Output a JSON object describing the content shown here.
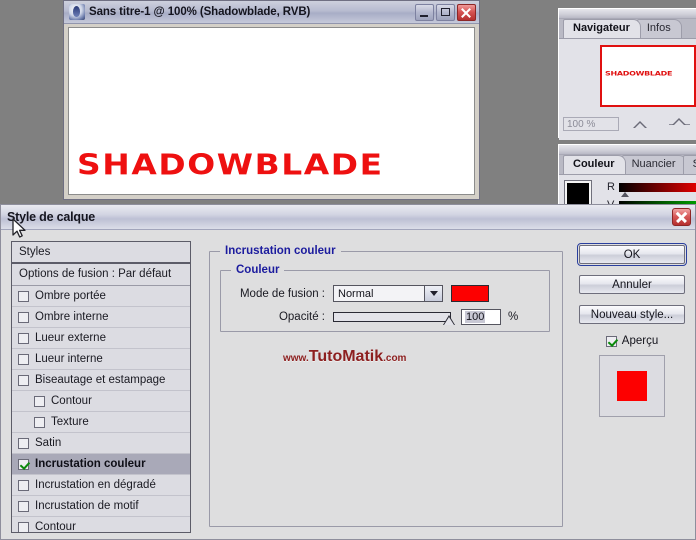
{
  "image_window": {
    "title": "Sans titre-1 @ 100% (Shadowblade, RVB)",
    "icon": "photoshop-icon",
    "minimize_label": "",
    "maximize_label": "",
    "close_label": "",
    "canvas_text": "SHADOWBLADE",
    "canvas_text_color": "#ee1010"
  },
  "navigator_palette": {
    "tabs": [
      {
        "label": "Navigateur",
        "active": true
      },
      {
        "label": "Infos",
        "active": false
      }
    ],
    "thumbnail_text": "SHADOWBLADE",
    "zoom_value": "100 %"
  },
  "color_palette": {
    "tabs": [
      {
        "label": "Couleur",
        "active": true
      },
      {
        "label": "Nuancier",
        "active": false
      },
      {
        "label": "S",
        "active": false
      }
    ],
    "channels": [
      {
        "label": "R"
      },
      {
        "label": "V"
      }
    ],
    "foreground_color": "#000000",
    "background_color": "#ffffff"
  },
  "dialog": {
    "title": "Style de calque",
    "close_label": "",
    "styles_panel": {
      "header": "Styles",
      "blending_row": "Options de fusion : Par défaut",
      "items": [
        {
          "label": "Ombre portée",
          "checked": false,
          "indent": false,
          "selected": false
        },
        {
          "label": "Ombre interne",
          "checked": false,
          "indent": false,
          "selected": false
        },
        {
          "label": "Lueur externe",
          "checked": false,
          "indent": false,
          "selected": false
        },
        {
          "label": "Lueur interne",
          "checked": false,
          "indent": false,
          "selected": false
        },
        {
          "label": "Biseautage et estampage",
          "checked": false,
          "indent": false,
          "selected": false
        },
        {
          "label": "Contour",
          "checked": false,
          "indent": true,
          "selected": false
        },
        {
          "label": "Texture",
          "checked": false,
          "indent": true,
          "selected": false
        },
        {
          "label": "Satin",
          "checked": false,
          "indent": false,
          "selected": false
        },
        {
          "label": "Incrustation couleur",
          "checked": true,
          "indent": false,
          "selected": true
        },
        {
          "label": "Incrustation en dégradé",
          "checked": false,
          "indent": false,
          "selected": false
        },
        {
          "label": "Incrustation de motif",
          "checked": false,
          "indent": false,
          "selected": false
        },
        {
          "label": "Contour",
          "checked": false,
          "indent": false,
          "selected": false
        }
      ]
    },
    "main_group": {
      "title": "Incrustation couleur",
      "subgroup_title": "Couleur",
      "blend_mode_label": "Mode de fusion :",
      "blend_mode_value": "Normal",
      "overlay_color": "#fd0000",
      "opacity_label": "Opacité :",
      "opacity_value": "100",
      "opacity_unit": "%"
    },
    "buttons": {
      "ok": "OK",
      "cancel": "Annuler",
      "new_style": "Nouveau style...",
      "preview_label": "Aperçu",
      "preview_checked": true,
      "preview_color": "#fd0000"
    }
  },
  "watermark": {
    "prefix": "www.",
    "main": "TutoMatik",
    "suffix": ".com"
  }
}
